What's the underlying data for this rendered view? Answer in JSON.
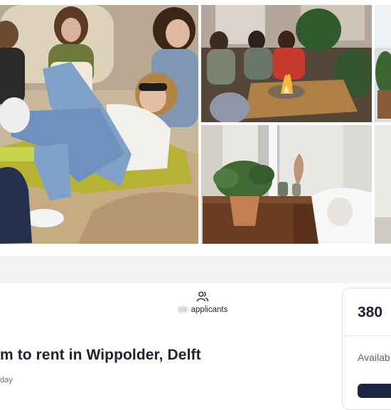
{
  "gallery": {
    "photos": [
      {
        "name": "friends-on-beach-photo"
      },
      {
        "name": "friends-around-firepit-photo"
      },
      {
        "name": "bedroom-with-plant-photo"
      },
      {
        "name": "cropped-plant-photo"
      },
      {
        "name": "cropped-room-photo"
      }
    ]
  },
  "listing": {
    "applicants_label": "applicants",
    "title": "m to rent in Wippolder, Delft",
    "posted": "day",
    "icon": "users-icon"
  },
  "card": {
    "price": "380",
    "availability": "Availab"
  },
  "colors": {
    "cta": "#1b2541",
    "band": "#f1f2f4",
    "border": "#dfe1e6"
  }
}
